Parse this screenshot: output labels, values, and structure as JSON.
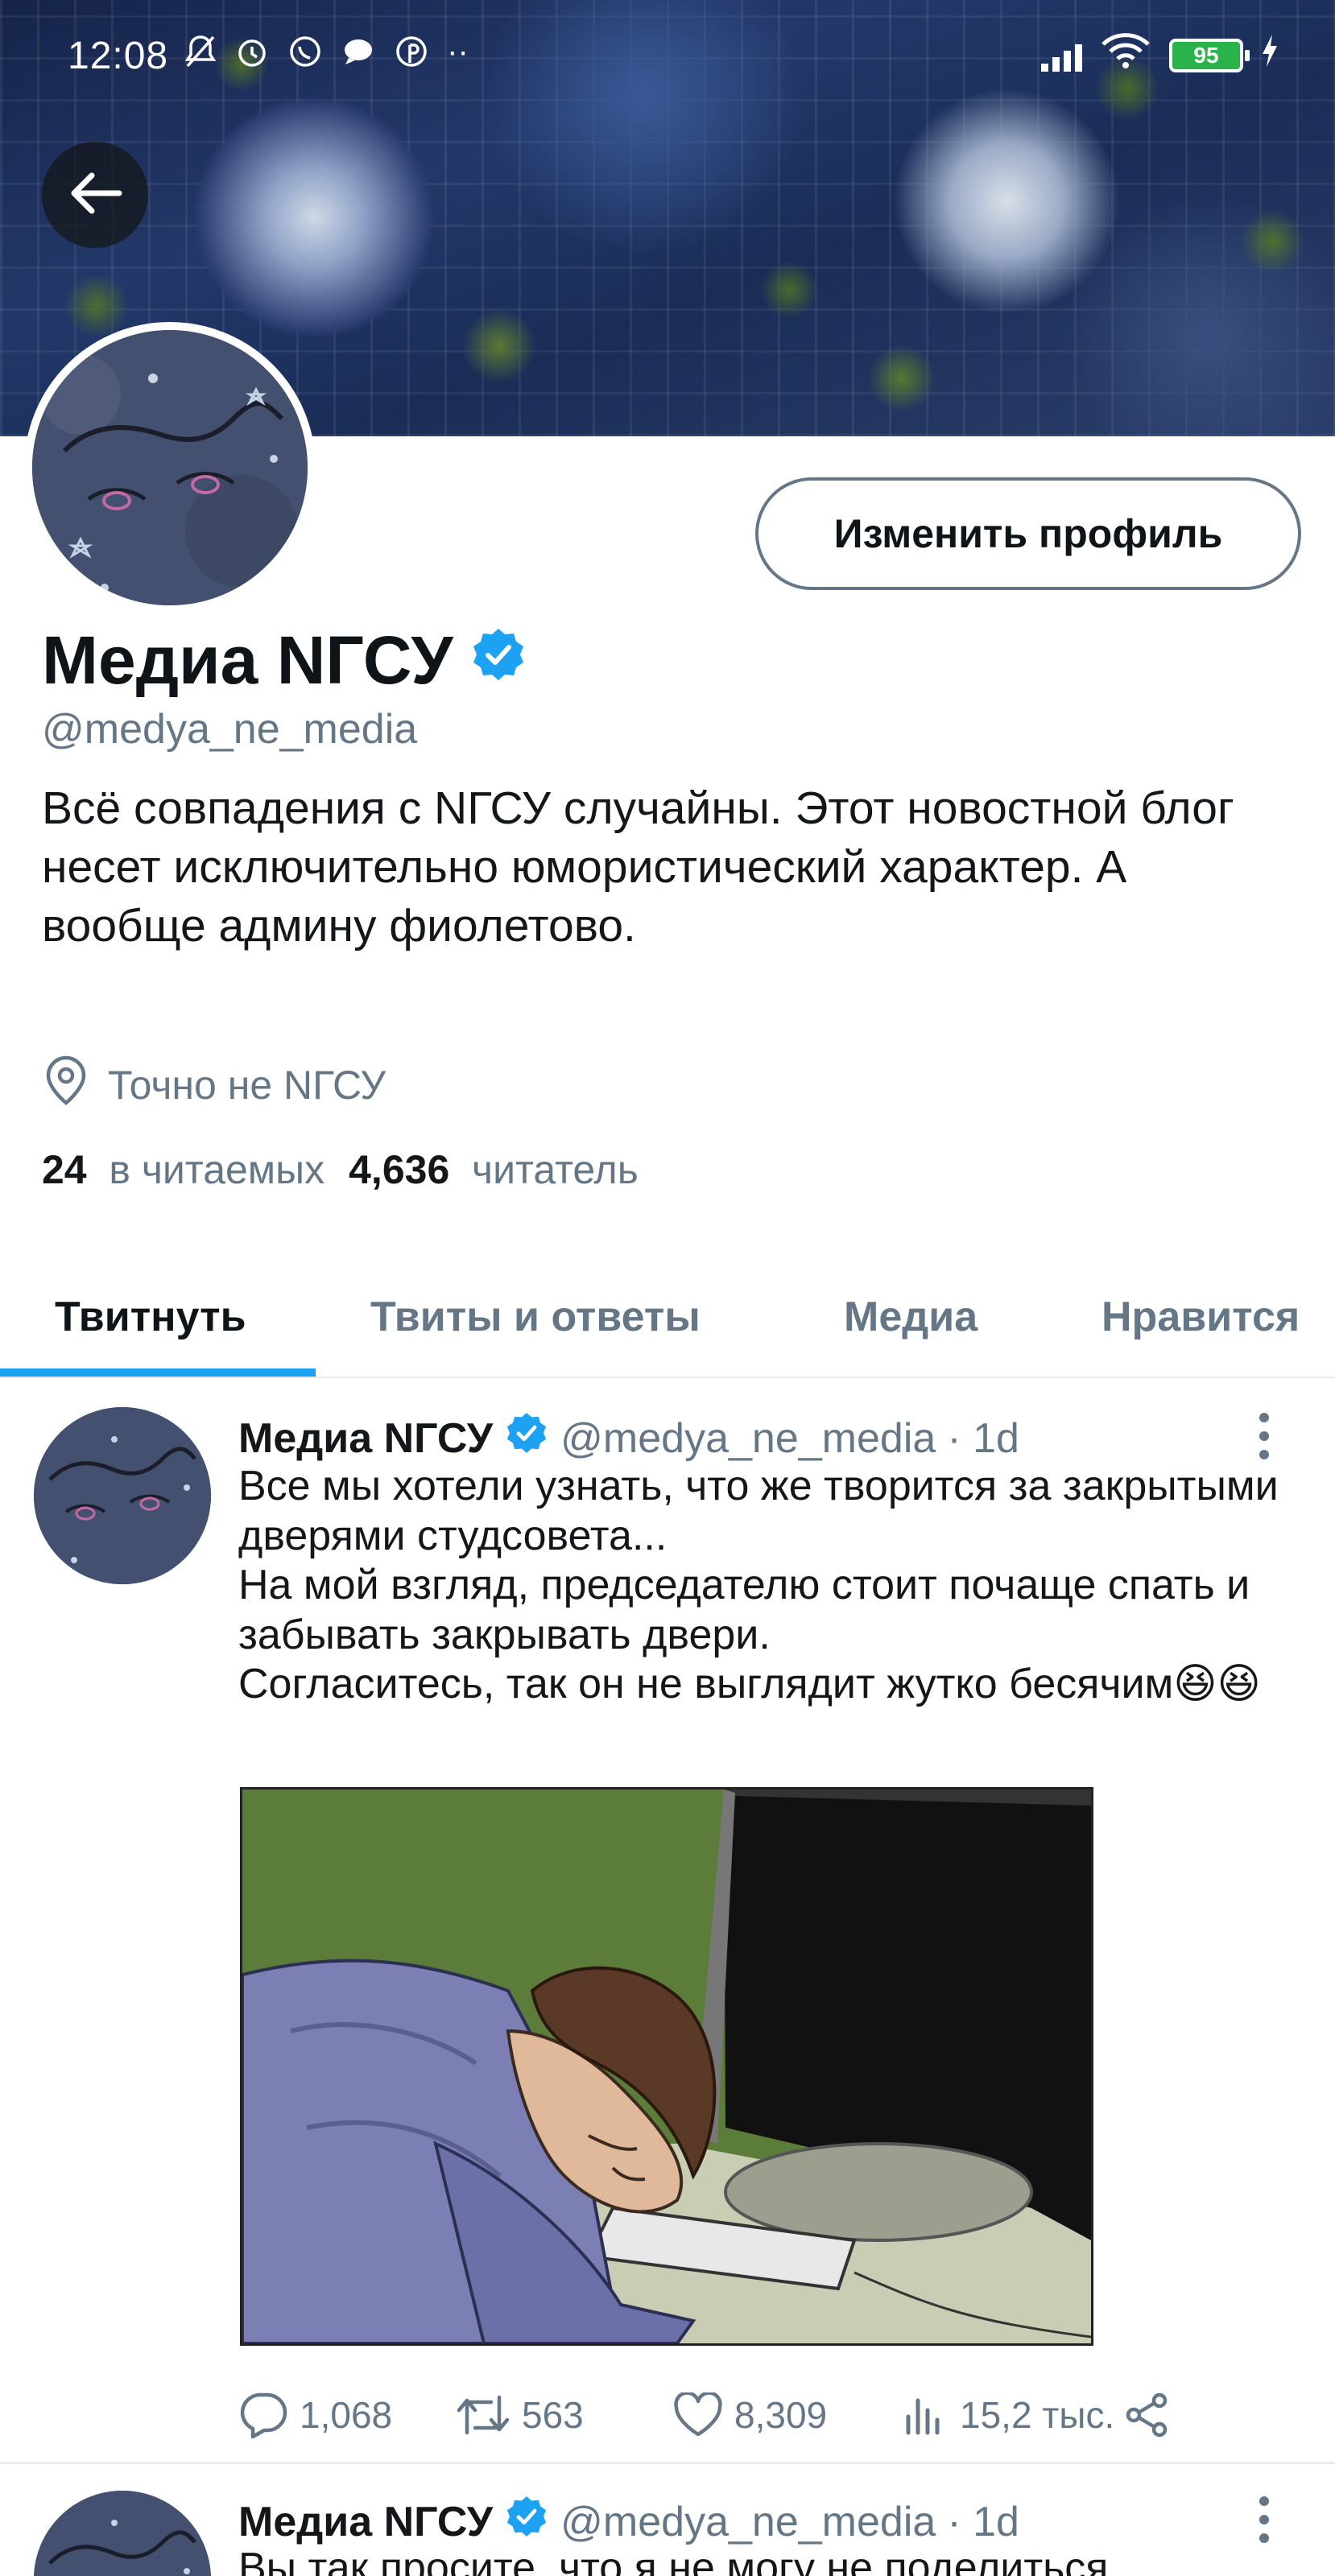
{
  "status_bar": {
    "time": "12:08",
    "battery": "95",
    "icons": [
      "bell-off-icon",
      "alarm-icon",
      "whatsapp-icon",
      "chat-icon",
      "pinterest-icon",
      "more-dots-icon",
      "signal-icon",
      "wifi-icon",
      "battery-icon",
      "charging-icon"
    ]
  },
  "profile": {
    "edit_button": "Изменить профиль",
    "name": "Медиа NГСУ",
    "handle": "@medya_ne_media",
    "bio": "Всё совпадения с NГСУ случайны. Этот новостной блог несет исключительно юмористический характер. А вообще админу фиолетово.",
    "location": "Точно не NГСУ",
    "following_count": "24",
    "following_label": "в читаемых",
    "followers_count": "4,636",
    "followers_label": "читатель",
    "accent_color": "#1da1f2"
  },
  "tabs": [
    {
      "label": "Твитнуть",
      "active": true
    },
    {
      "label": "Твиты и ответы",
      "active": false
    },
    {
      "label": "Медиа",
      "active": false
    },
    {
      "label": "Нравится",
      "active": false
    }
  ],
  "tweets": [
    {
      "name": "Медиа NГСУ",
      "handle": "@medya_ne_media",
      "time": "· 1d",
      "text": "Все мы хотели узнать, что же творится за закрытыми дверями студсовета...\nНа мой взгляд, председателю стоит почаще спать и забывать закрывать двери.\nСогласитесь, так он не выглядит жутко бесячим😆😆",
      "replies": "1,068",
      "retweets": "563",
      "likes": "8,309",
      "views": "15,2 тыс."
    },
    {
      "name": "Медиа NГСУ",
      "handle": "@medya_ne_media",
      "time": "· 1d",
      "text": "Вы так просите, что я не могу не поделиться"
    }
  ]
}
